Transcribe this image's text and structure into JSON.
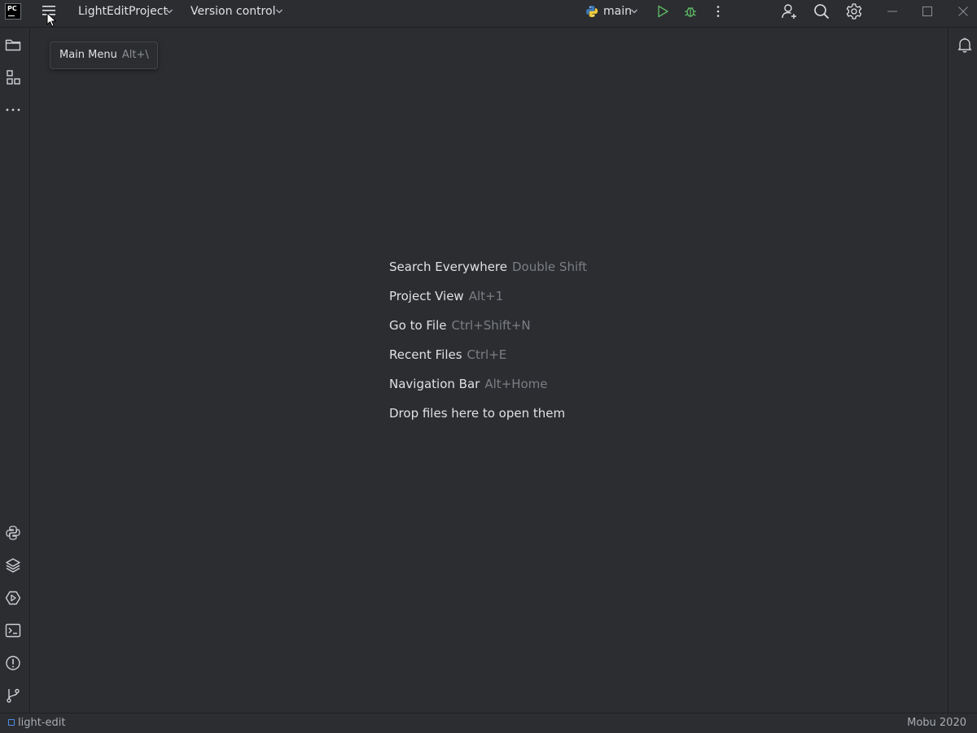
{
  "titlebar": {
    "app_logo_text": "PC",
    "project_label": "LightEditProject",
    "vcs_label": "Version control",
    "run_config_label": "main"
  },
  "tooltip": {
    "label": "Main Menu",
    "shortcut": "Alt+\\"
  },
  "editor": {
    "hints": [
      {
        "action": "Search Everywhere",
        "shortcut": "Double Shift"
      },
      {
        "action": "Project View",
        "shortcut": "Alt+1"
      },
      {
        "action": "Go to File",
        "shortcut": "Ctrl+Shift+N"
      },
      {
        "action": "Recent Files",
        "shortcut": "Ctrl+E"
      },
      {
        "action": "Navigation Bar",
        "shortcut": "Alt+Home"
      }
    ],
    "drop_hint": "Drop files here to open them"
  },
  "statusbar": {
    "left_label": "light-edit",
    "right_label": "Mobu 2020"
  },
  "colors": {
    "background": "#2b2d30",
    "text": "#dfe1e5",
    "shortcut_text": "#7b7e84",
    "run_green": "#5fb865",
    "accent_blue": "#4e8ee8"
  },
  "icons": {
    "left_strip_top": [
      "folder-icon",
      "structure-icon",
      "more-horizontal-icon"
    ],
    "left_strip_bottom": [
      "python-console-icon",
      "layers-icon",
      "services-icon",
      "terminal-icon",
      "problems-icon",
      "git-icon"
    ],
    "titlebar": [
      "hamburger-menu-icon",
      "python-icon",
      "run-icon",
      "debug-icon",
      "more-vertical-icon",
      "add-user-icon",
      "search-icon",
      "settings-icon",
      "minimize-icon",
      "maximize-icon",
      "close-icon"
    ],
    "right_strip": [
      "notifications-icon"
    ]
  }
}
